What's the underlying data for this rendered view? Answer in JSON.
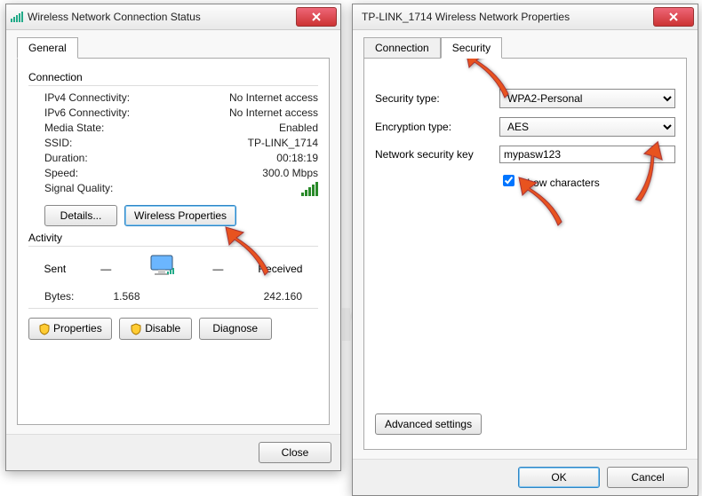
{
  "left": {
    "title": "Wireless Network Connection Status",
    "tab_general": "General",
    "grp_connection": "Connection",
    "ipv4_lbl": "IPv4 Connectivity:",
    "ipv4_val": "No Internet access",
    "ipv6_lbl": "IPv6 Connectivity:",
    "ipv6_val": "No Internet access",
    "media_lbl": "Media State:",
    "media_val": "Enabled",
    "ssid_lbl": "SSID:",
    "ssid_val": "TP-LINK_1714",
    "dur_lbl": "Duration:",
    "dur_val": "00:18:19",
    "speed_lbl": "Speed:",
    "speed_val": "300.0 Mbps",
    "sig_lbl": "Signal Quality:",
    "btn_details": "Details...",
    "btn_wp": "Wireless Properties",
    "grp_activity": "Activity",
    "sent": "Sent",
    "recv": "Received",
    "bytes_lbl": "Bytes:",
    "bytes_sent": "1.568",
    "bytes_recv": "242.160",
    "btn_props": "Properties",
    "btn_disable": "Disable",
    "btn_diag": "Diagnose",
    "btn_close": "Close"
  },
  "right": {
    "title": "TP-LINK_1714 Wireless Network Properties",
    "tab_conn": "Connection",
    "tab_sec": "Security",
    "sectype_lbl": "Security type:",
    "sectype_val": "WPA2-Personal",
    "enctype_lbl": "Encryption type:",
    "enctype_val": "AES",
    "key_lbl": "Network security key",
    "key_val": "mypasw123",
    "show_chars": "Show characters",
    "btn_adv": "Advanced settings",
    "btn_ok": "OK",
    "btn_cancel": "Cancel"
  }
}
